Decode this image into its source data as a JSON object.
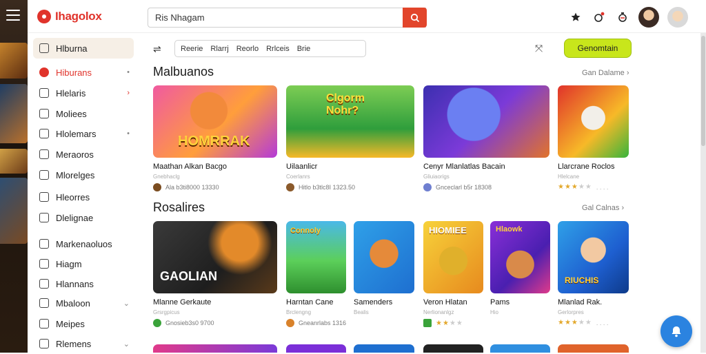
{
  "app": {
    "logo_text": "Ihagolox"
  },
  "search": {
    "value": "Ris Nhagam"
  },
  "sidebar": {
    "items": [
      {
        "label": "Hlburna",
        "right": ""
      },
      {
        "label": "Hiburans",
        "right": "•"
      },
      {
        "label": "Hlelaris",
        "right": "›"
      },
      {
        "label": "Moliees",
        "right": ""
      },
      {
        "label": "Hlolemars",
        "right": "•"
      },
      {
        "label": "Meraoros",
        "right": ""
      },
      {
        "label": "Mlorelges",
        "right": ""
      },
      {
        "label": "Hleorres",
        "right": ""
      },
      {
        "label": "Dlelignae",
        "right": ""
      },
      {
        "label": "Markenaoluos",
        "right": ""
      },
      {
        "label": "Hiagm",
        "right": ""
      },
      {
        "label": "Hlannans",
        "right": ""
      },
      {
        "label": "Mbaloon",
        "right": "⌄"
      },
      {
        "label": "Meipes",
        "right": ""
      },
      {
        "label": "Rlemens",
        "right": "⌄"
      }
    ]
  },
  "filters": {
    "chips": [
      "Reerie",
      "Rlarrj",
      "Reorlo",
      "Rrlceis",
      "Brie"
    ],
    "cta_label": "Genomtain"
  },
  "sections": [
    {
      "title": "Malbuanos",
      "see_all": "Gan Dalame",
      "cards": [
        {
          "thumb_text": "HOMRRAK",
          "title": "Maathan Alkan Bacgo",
          "sub": "Gnebhaclg",
          "meta": "Ala b3ti8000  13330"
        },
        {
          "thumb_text": "Clgorm Nohr?",
          "title": "Uilaanlicr",
          "sub": "Coerlanrs",
          "meta": "Hitlo b3tlc8I  1323.50"
        },
        {
          "thumb_text": "",
          "title": "Cenyr Mlanlatlas Bacain",
          "sub": "Gliuiaorigs",
          "meta": "Gnceclarl b5r  18308"
        },
        {
          "thumb_text": "",
          "title": "Llarcrane Roclos",
          "sub": "Hlelcane",
          "stars": 3,
          "meta": ""
        }
      ]
    },
    {
      "title": "Rosalires",
      "see_all": "Gal Calnas",
      "cards": [
        {
          "thumb_text": "GAOLIAN",
          "title": "Mlanne Gerkaute",
          "sub": "Grsrgpicus",
          "meta": "Gnosieb3s0  9700"
        },
        {
          "thumb_text": "Connoly",
          "title": "Harntan Cane",
          "sub": "Brclengng",
          "meta": "Gneanrlabs  1316"
        },
        {
          "thumb_text": "",
          "title": "Samenders",
          "sub": "Bealis",
          "meta": ""
        },
        {
          "thumb_text": "HIOMIEE",
          "title": "Veron Hlatan",
          "sub": "Nerlionanlgz",
          "stars": 2,
          "meta": ""
        },
        {
          "thumb_text": "Hlaowk",
          "title": "Pams",
          "sub": "Hio",
          "meta": ""
        },
        {
          "thumb_text": "RIUCHIS",
          "title": "Mlanlad Rak.",
          "sub": "Gerlorpres",
          "stars": 3,
          "meta": ""
        }
      ]
    }
  ]
}
